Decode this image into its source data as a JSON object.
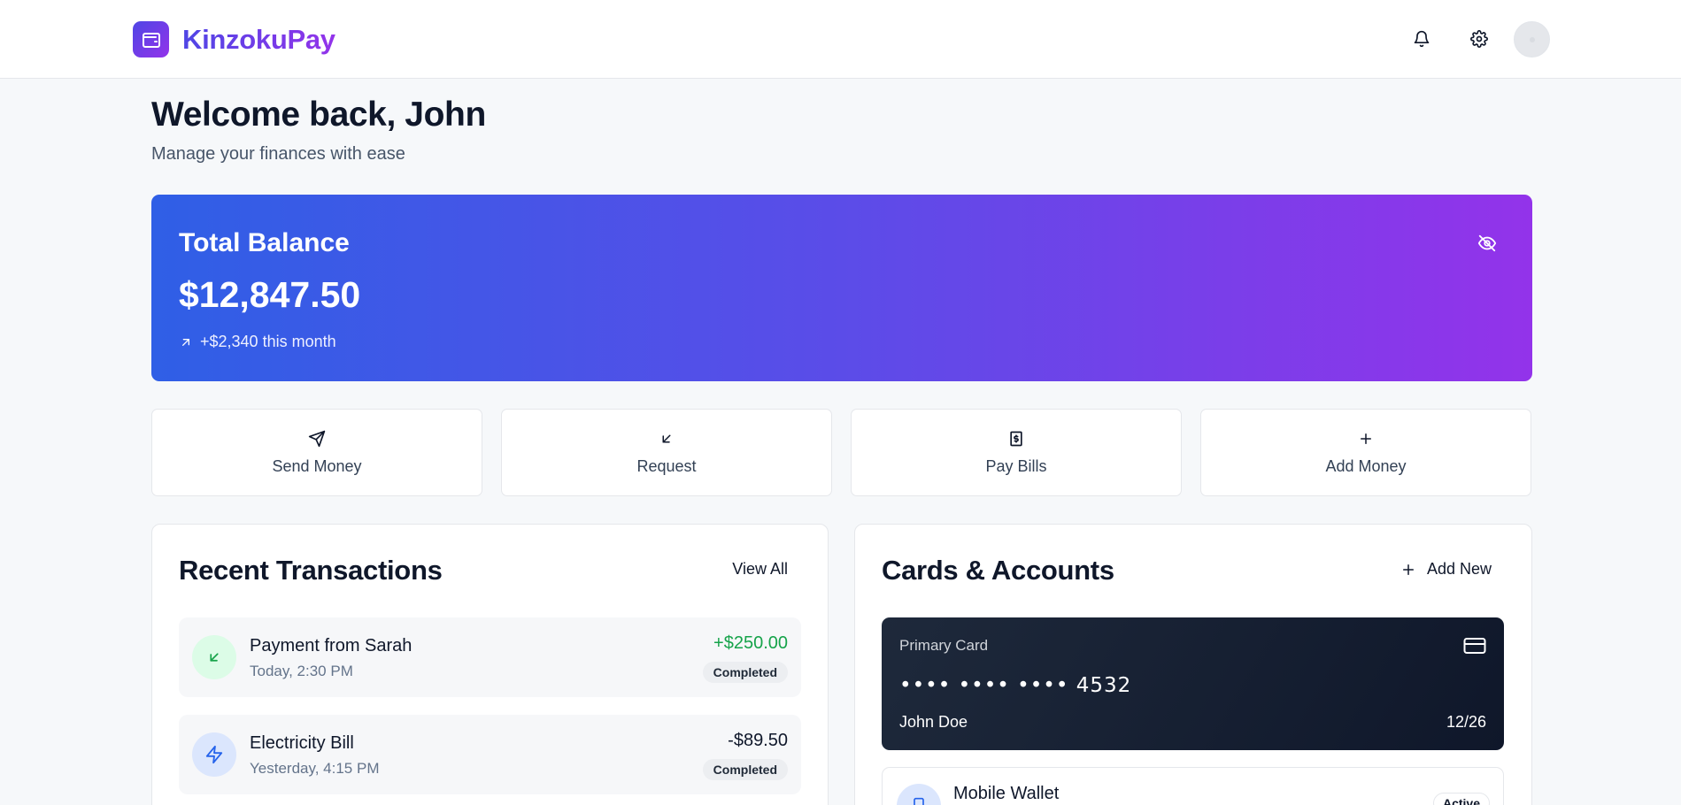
{
  "brand": {
    "name": "KinzokuPay",
    "logo_icon": "wallet-icon"
  },
  "header": {
    "icons": [
      "bell-icon",
      "gear-icon"
    ],
    "avatar": "avatar"
  },
  "welcome": {
    "title": "Welcome back, John",
    "subtitle": "Manage your finances with ease"
  },
  "balance": {
    "label": "Total Balance",
    "amount": "$12,847.50",
    "change": "+$2,340 this month",
    "toggle_icon": "eye-off-icon"
  },
  "actions": [
    {
      "label": "Send Money",
      "icon": "send-icon"
    },
    {
      "label": "Request",
      "icon": "arrow-down-left-icon"
    },
    {
      "label": "Pay Bills",
      "icon": "receipt-icon"
    },
    {
      "label": "Add Money",
      "icon": "plus-icon"
    }
  ],
  "transactions": {
    "title": "Recent Transactions",
    "view_all": "View All",
    "items": [
      {
        "name": "Payment from Sarah",
        "time": "Today, 2:30 PM",
        "amount": "+$250.00",
        "status": "Completed",
        "icon": "arrow-down-left-icon",
        "amount_color": "#16a34a"
      },
      {
        "name": "Electricity Bill",
        "time": "Yesterday, 4:15 PM",
        "amount": "-$89.50",
        "status": "Completed",
        "icon": "lightning-icon",
        "amount_color": "#0f172a"
      }
    ]
  },
  "cards": {
    "title": "Cards & Accounts",
    "add_new": "Add New",
    "primary": {
      "label": "Primary Card",
      "masked": "•••• •••• ••••",
      "last4": "4532",
      "holder": "John Doe",
      "expiry": "12/26"
    },
    "wallet": {
      "name": "Mobile Wallet",
      "status": "Active"
    }
  },
  "colors": {
    "accent_start": "#2f5fe6",
    "accent_end": "#9333ea",
    "positive": "#16a34a",
    "card_dark": "#0f172a"
  }
}
